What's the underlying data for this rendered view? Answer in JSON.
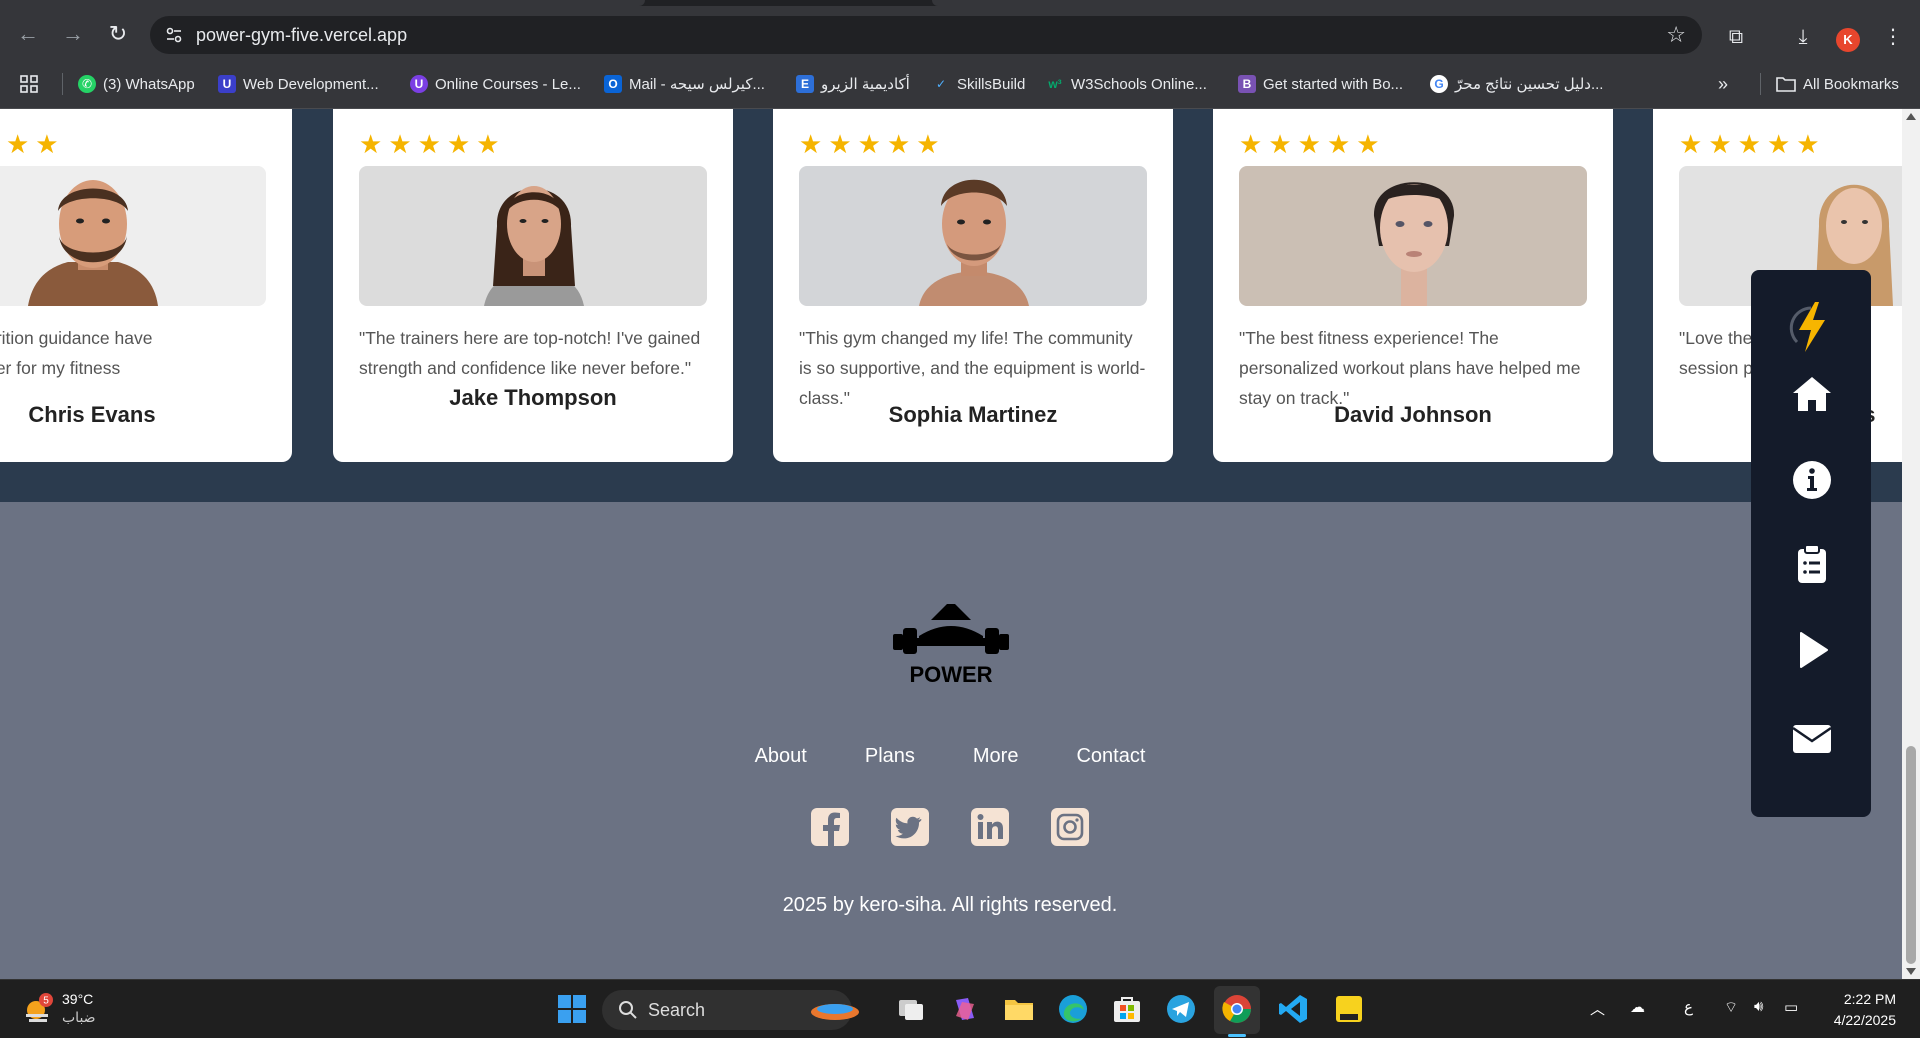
{
  "browser": {
    "url": "power-gym-five.vercel.app",
    "avatar_letter": "K",
    "bookmarks": [
      {
        "label": "(3) WhatsApp",
        "icon": "whatsapp-icon"
      },
      {
        "label": "Web Development...",
        "icon": "web-dev-icon"
      },
      {
        "label": "Online Courses - Le...",
        "icon": "udemy-icon"
      },
      {
        "label": "Mail - كيرلس سيحه...",
        "icon": "outlook-icon"
      },
      {
        "label": "أكاديمية الزيرو",
        "icon": "e-icon"
      },
      {
        "label": "SkillsBuild",
        "icon": "skillsbuild-icon"
      },
      {
        "label": "W3Schools Online...",
        "icon": "w3schools-icon"
      },
      {
        "label": "Get started with Bo...",
        "icon": "bootstrap-icon"
      },
      {
        "label": "دليل تحسين نتائج محرّ...",
        "icon": "google-icon"
      }
    ],
    "all_bookmarks_label": "All Bookmarks"
  },
  "testimonials": [
    {
      "quote": "rs and nutrition guidance have\nme-changer for my fitness",
      "name": "Chris Evans",
      "stars": 5
    },
    {
      "quote": "\"The trainers here are top-notch! I've gained strength and confidence like never before.\"",
      "name": "Jake Thompson",
      "stars": 5
    },
    {
      "quote": "\"This gym changed my life! The community is so supportive, and the equipment is world-class.\"",
      "name": "Sophia Martinez",
      "stars": 5
    },
    {
      "quote": "\"The best fitness experience! The personalized workout plans have helped me stay on track.\"",
      "name": "David Johnson",
      "stars": 5
    },
    {
      "quote": "\"Love the\nsession p",
      "name": "Wils",
      "stars": 5
    }
  ],
  "footer": {
    "logo_text": "POWER",
    "nav": [
      "About",
      "Plans",
      "More",
      "Contact"
    ],
    "socials": [
      "facebook-icon",
      "twitter-icon",
      "linkedin-icon",
      "instagram-icon"
    ],
    "copyright": "2025 by kero-siha. All rights reserved."
  },
  "sidenav": [
    "lightning-icon",
    "home-icon",
    "info-icon",
    "clipboard-list-icon",
    "play-icon",
    "envelope-icon"
  ],
  "taskbar": {
    "weather_temp": "39°C",
    "weather_cond": "ضباب",
    "weather_badge": "5",
    "search_label": "Search",
    "time": "2:22 PM",
    "date": "4/22/2025",
    "lang": "ع"
  },
  "colors": {
    "testimonial_bg": "#2b3b4e",
    "footer_bg": "#6b7283",
    "star": "#f5b400",
    "sidenav_bg": "#141b2a"
  }
}
